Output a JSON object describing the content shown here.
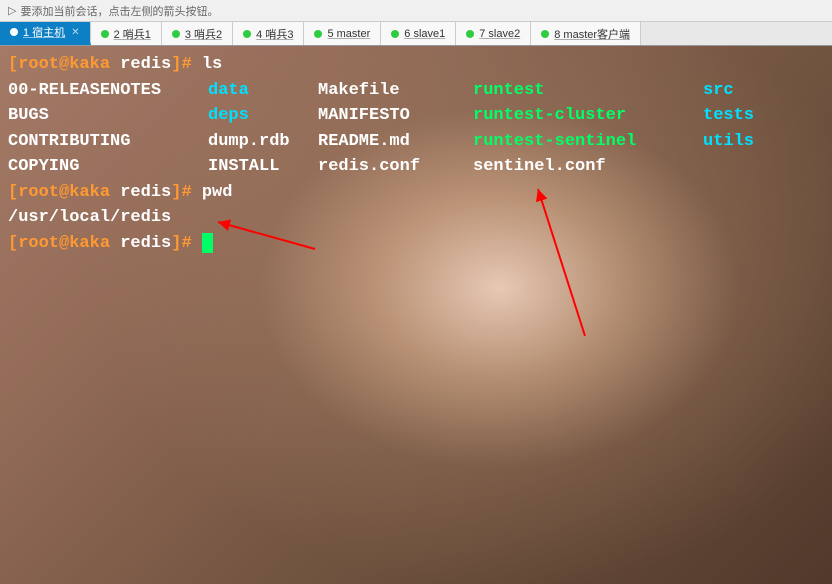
{
  "hint": {
    "text": "要添加当前会话，点击左侧的箭头按钮。"
  },
  "tabs": [
    {
      "label": "1 宿主机",
      "active": true
    },
    {
      "label": "2 哨兵1",
      "active": false
    },
    {
      "label": "3 哨兵2",
      "active": false
    },
    {
      "label": "4 哨兵3",
      "active": false
    },
    {
      "label": "5 master",
      "active": false
    },
    {
      "label": "6 slave1",
      "active": false
    },
    {
      "label": "7 slave2",
      "active": false
    },
    {
      "label": "8 master客户端",
      "active": false
    }
  ],
  "terminal": {
    "prompt_open": "[",
    "prompt_user": "root@kaka",
    "prompt_sep": " ",
    "prompt_dir": "redis",
    "prompt_close": "]# ",
    "cmd_ls": "ls",
    "cmd_pwd": "pwd",
    "pwd_output": "/usr/local/redis",
    "ls": {
      "c1": [
        "00-RELEASENOTES",
        "BUGS",
        "CONTRIBUTING",
        "COPYING"
      ],
      "c2": [
        "data",
        "deps",
        "dump.rdb",
        "INSTALL"
      ],
      "c3": [
        "Makefile",
        "MANIFESTO",
        "README.md",
        "redis.conf"
      ],
      "c4": [
        "runtest",
        "runtest-cluster",
        "runtest-sentinel",
        "sentinel.conf"
      ],
      "c5": [
        "src",
        "tests",
        "utils"
      ]
    }
  }
}
